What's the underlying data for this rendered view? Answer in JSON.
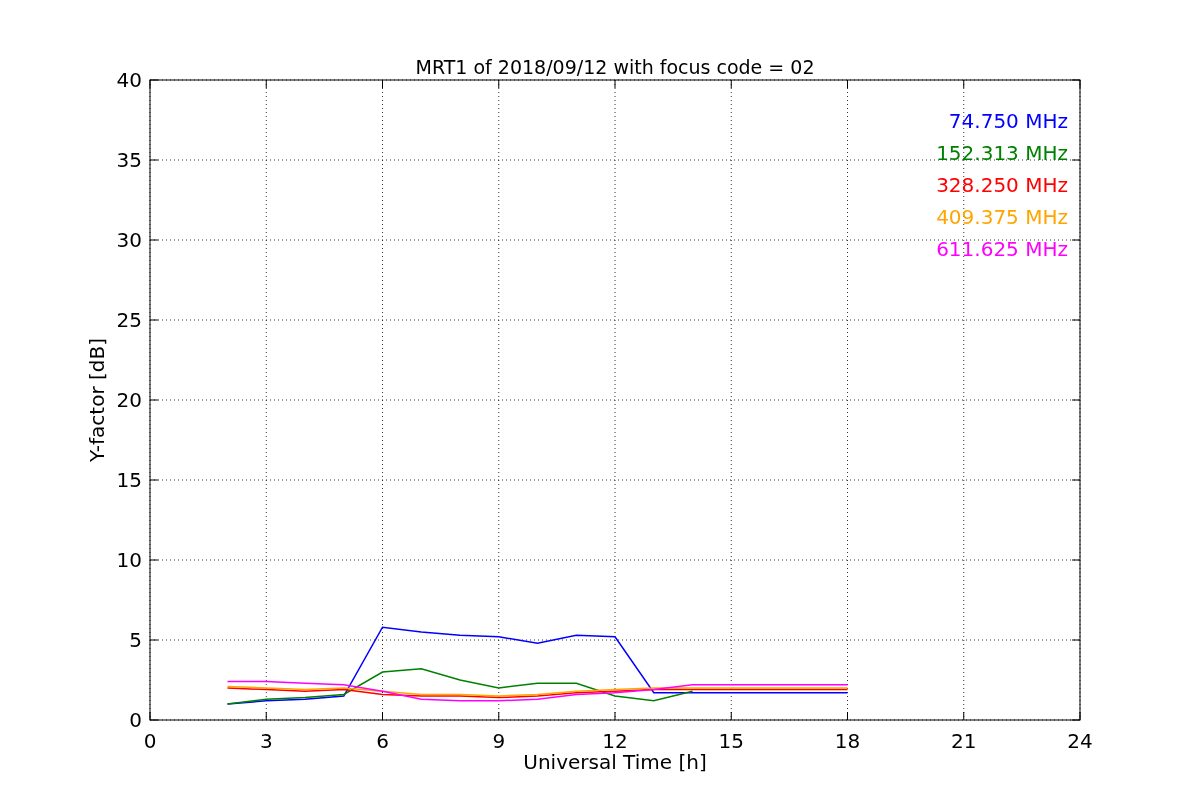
{
  "chart_data": {
    "type": "line",
    "title": "MRT1 of 2018/09/12 with focus code = 02",
    "xlabel": "Universal Time [h]",
    "ylabel": "Y-factor [dB]",
    "x": [
      2,
      3,
      4,
      5,
      6,
      7,
      8,
      9,
      10,
      11,
      12,
      13,
      14,
      15,
      16,
      17,
      18
    ],
    "series": [
      {
        "name": "74.750 MHz",
        "color": "#0000ff",
        "values": [
          1.0,
          1.2,
          1.3,
          1.5,
          5.8,
          5.5,
          5.3,
          5.2,
          4.8,
          5.3,
          5.2,
          1.7,
          1.7,
          1.7,
          1.7,
          1.7,
          1.7
        ]
      },
      {
        "name": "152.313 MHz",
        "color": "#008000",
        "values": [
          1.0,
          1.3,
          1.4,
          1.6,
          3.0,
          3.2,
          2.5,
          2.0,
          2.3,
          2.3,
          1.5,
          1.2,
          1.8,
          null,
          null,
          null,
          null
        ]
      },
      {
        "name": "328.250 MHz",
        "color": "#ff0000",
        "values": [
          2.0,
          1.9,
          1.8,
          1.9,
          1.6,
          1.5,
          1.5,
          1.4,
          1.5,
          1.7,
          1.8,
          1.9,
          1.9,
          1.9,
          1.9,
          1.9,
          1.9
        ]
      },
      {
        "name": "409.375 MHz",
        "color": "#ffa500",
        "values": [
          2.1,
          2.0,
          1.9,
          2.0,
          1.8,
          1.6,
          1.6,
          1.5,
          1.6,
          1.8,
          1.9,
          2.0,
          2.0,
          2.0,
          2.0,
          2.0,
          2.0
        ]
      },
      {
        "name": "611.625 MHz",
        "color": "#ff00ff",
        "values": [
          2.4,
          2.4,
          2.3,
          2.2,
          1.8,
          1.3,
          1.2,
          1.2,
          1.3,
          1.6,
          1.7,
          1.9,
          2.2,
          2.2,
          2.2,
          2.2,
          2.2
        ]
      }
    ],
    "grid": true,
    "xlim": [
      0,
      24
    ],
    "ylim": [
      0,
      40
    ],
    "xticks": [
      0,
      3,
      6,
      9,
      12,
      15,
      18,
      21,
      24
    ],
    "yticks": [
      0,
      5,
      10,
      15,
      20,
      25,
      30,
      35,
      40
    ]
  }
}
